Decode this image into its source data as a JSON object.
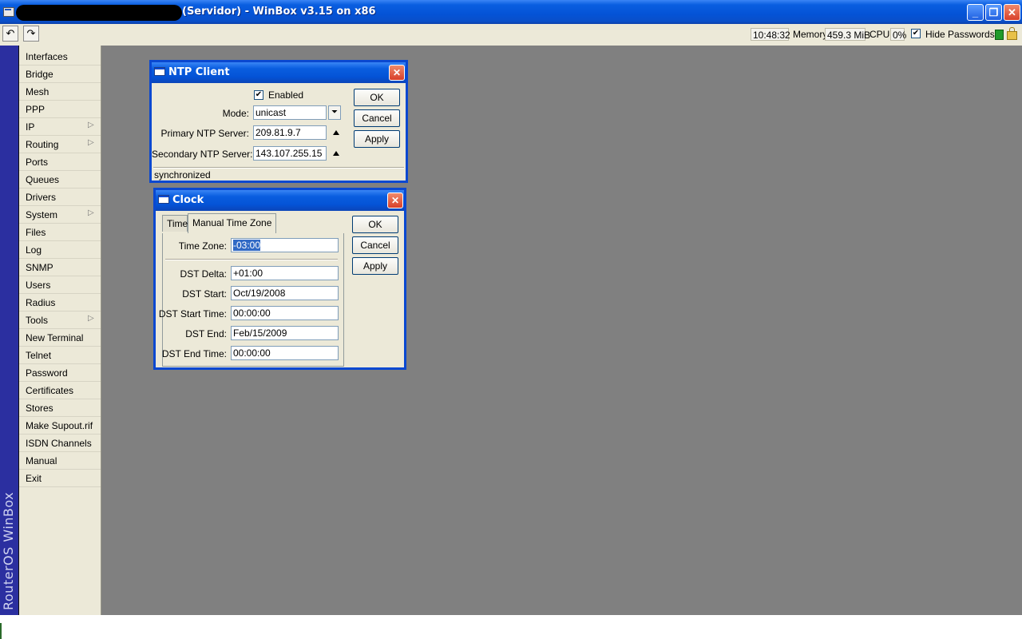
{
  "window": {
    "title": "(Servidor) - WinBox v3.15 on x86",
    "min_glyph": "_",
    "max_glyph": "❐",
    "close_glyph": "✕"
  },
  "toolbar": {
    "undo_glyph": "↶",
    "redo_glyph": "↷",
    "time": "10:48:32",
    "memory_label": "Memory:",
    "memory_value": "459.3 MiB",
    "cpu_label": "CPU:",
    "cpu_value": "0%",
    "hide_passwords_checked_glyph": "✔",
    "hide_passwords_label": "Hide Passwords"
  },
  "brand": {
    "text": "RouterOS WinBox"
  },
  "sidebar": {
    "items": [
      {
        "label": "Interfaces",
        "arrow": ""
      },
      {
        "label": "Bridge",
        "arrow": ""
      },
      {
        "label": "Mesh",
        "arrow": ""
      },
      {
        "label": "PPP",
        "arrow": ""
      },
      {
        "label": "IP",
        "arrow": "▷"
      },
      {
        "label": "Routing",
        "arrow": "▷"
      },
      {
        "label": "Ports",
        "arrow": ""
      },
      {
        "label": "Queues",
        "arrow": ""
      },
      {
        "label": "Drivers",
        "arrow": ""
      },
      {
        "label": "System",
        "arrow": "▷"
      },
      {
        "label": "Files",
        "arrow": ""
      },
      {
        "label": "Log",
        "arrow": ""
      },
      {
        "label": "SNMP",
        "arrow": ""
      },
      {
        "label": "Users",
        "arrow": ""
      },
      {
        "label": "Radius",
        "arrow": ""
      },
      {
        "label": "Tools",
        "arrow": "▷"
      },
      {
        "label": "New Terminal",
        "arrow": ""
      },
      {
        "label": "Telnet",
        "arrow": ""
      },
      {
        "label": "Password",
        "arrow": ""
      },
      {
        "label": "Certificates",
        "arrow": ""
      },
      {
        "label": "Stores",
        "arrow": ""
      },
      {
        "label": "Make Supout.rif",
        "arrow": ""
      },
      {
        "label": "ISDN Channels",
        "arrow": ""
      },
      {
        "label": "Manual",
        "arrow": ""
      },
      {
        "label": "Exit",
        "arrow": ""
      }
    ]
  },
  "ntp": {
    "title": "NTP Client",
    "close_glyph": "✕",
    "enabled_check_glyph": "✔",
    "enabled_label": "Enabled",
    "mode_label": "Mode:",
    "mode_value": "unicast",
    "mode_dropdown_glyph": "⏷",
    "primary_label": "Primary NTP Server:",
    "primary_value": "209.81.9.7",
    "secondary_label": "Secondary NTP Server:",
    "secondary_value": "143.107.255.15",
    "ok": "OK",
    "cancel": "Cancel",
    "apply": "Apply",
    "status": "synchronized"
  },
  "clock": {
    "title": "Clock",
    "close_glyph": "✕",
    "tabs": [
      {
        "label": "Time"
      },
      {
        "label": "Manual Time Zone"
      }
    ],
    "time_zone_label": "Time Zone:",
    "time_zone_value": "-03:00",
    "dst_delta_label": "DST Delta:",
    "dst_delta_value": "+01:00",
    "dst_start_label": "DST Start:",
    "dst_start_value": "Oct/19/2008",
    "dst_start_time_label": "DST Start Time:",
    "dst_start_time_value": "00:00:00",
    "dst_end_label": "DST End:",
    "dst_end_value": "Feb/15/2009",
    "dst_end_time_label": "DST End Time:",
    "dst_end_time_value": "00:00:00",
    "ok": "OK",
    "cancel": "Cancel",
    "apply": "Apply"
  },
  "colors": {
    "titlebar_blue": "#0a5ee0",
    "desktop_gray": "#808080",
    "panel_beige": "#ece9d8",
    "brand_blue": "#2b2fa0"
  }
}
